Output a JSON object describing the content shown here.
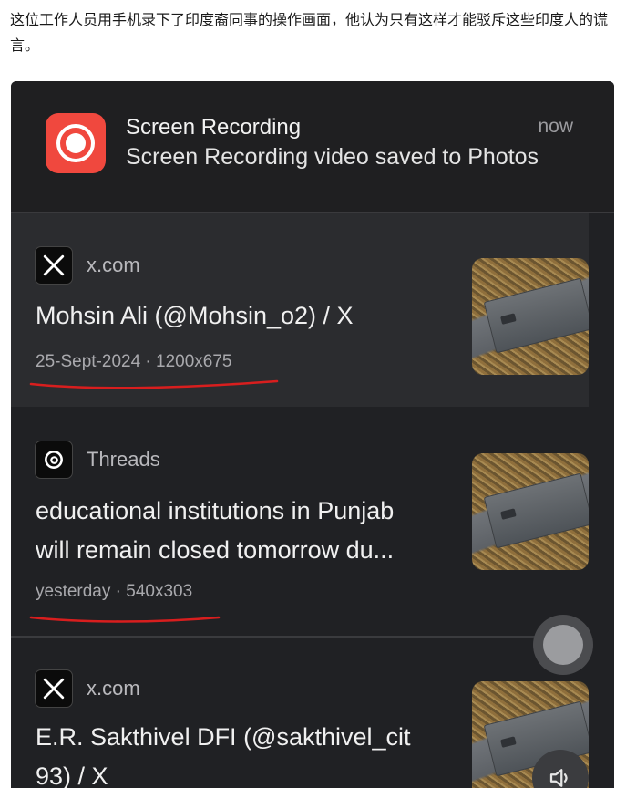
{
  "caption": "这位工作人员用手机录下了印度裔同事的操作画面，他认为只有这样才能驳斥这些印度人的谎言。",
  "notification": {
    "title": "Screen Recording",
    "body": "Screen Recording video saved to Photos",
    "time": "now",
    "icon": "screen-recording-icon",
    "accent": "#f0483e"
  },
  "results": [
    {
      "source": "x.com",
      "source_icon": "x-logo-icon",
      "title": "Mohsin Ali (@Mohsin_o2) / X",
      "meta": "25-Sept-2024 · 1200x675"
    },
    {
      "source": "Threads",
      "source_icon": "threads-logo-icon",
      "title_line1": "educational institutions in Punjab",
      "title_line2": "will remain closed tomorrow du...",
      "meta": "yesterday · 540x303"
    },
    {
      "source": "x.com",
      "source_icon": "x-logo-icon",
      "title_line1": "E.R. Sakthivel DFI (@sakthivel_cit",
      "title_line2": "93) / X"
    }
  ],
  "annotation_color": "#d81e1e"
}
